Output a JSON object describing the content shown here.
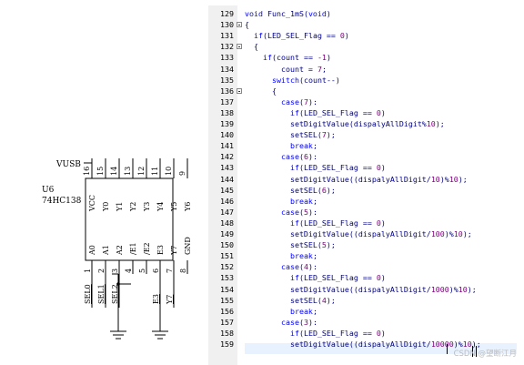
{
  "schematic": {
    "vcc_net": "VUSB",
    "ref": "U6",
    "part": "74HC138",
    "top_pins": [
      {
        "num": "16",
        "name": "VCC"
      },
      {
        "num": "15",
        "name": "Y0"
      },
      {
        "num": "14",
        "name": "Y1"
      },
      {
        "num": "13",
        "name": "Y2"
      },
      {
        "num": "12",
        "name": "Y3"
      },
      {
        "num": "11",
        "name": "Y4"
      },
      {
        "num": "10",
        "name": "Y5"
      },
      {
        "num": "9",
        "name": "Y6"
      }
    ],
    "bottom_pins": [
      {
        "num": "1",
        "name": "A0",
        "net": "SEL0"
      },
      {
        "num": "2",
        "name": "A1",
        "net": "SEL1"
      },
      {
        "num": "3",
        "name": "A2",
        "net": "SEL2"
      },
      {
        "num": "4",
        "name": "/E1",
        "net": ""
      },
      {
        "num": "5",
        "name": "/E2",
        "net": ""
      },
      {
        "num": "6",
        "name": "E3",
        "net": "E3"
      },
      {
        "num": "7",
        "name": "Y7",
        "net": "Y7"
      },
      {
        "num": "8",
        "name": "GND",
        "net": ""
      }
    ]
  },
  "editor": {
    "lines": [
      {
        "n": "129",
        "fold": false,
        "t": "void Func_1mS(void)"
      },
      {
        "n": "130",
        "fold": true,
        "t": "{"
      },
      {
        "n": "131",
        "fold": false,
        "t": "  if(LED_SEL_Flag == 0)"
      },
      {
        "n": "132",
        "fold": true,
        "t": "  {"
      },
      {
        "n": "133",
        "fold": false,
        "t": "    if(count == -1)"
      },
      {
        "n": "134",
        "fold": false,
        "t": "        count = 7;"
      },
      {
        "n": "135",
        "fold": false,
        "t": "      switch(count--)"
      },
      {
        "n": "136",
        "fold": true,
        "t": "      {"
      },
      {
        "n": "137",
        "fold": false,
        "t": "        case(7):"
      },
      {
        "n": "138",
        "fold": false,
        "t": "          if(LED_SEL_Flag == 0)"
      },
      {
        "n": "139",
        "fold": false,
        "t": "          setDigitValue(dispalyAllDigit%10);"
      },
      {
        "n": "140",
        "fold": false,
        "t": "          setSEL(7);"
      },
      {
        "n": "141",
        "fold": false,
        "t": "          break;"
      },
      {
        "n": "142",
        "fold": false,
        "t": "        case(6):"
      },
      {
        "n": "143",
        "fold": false,
        "t": "          if(LED_SEL_Flag == 0)"
      },
      {
        "n": "144",
        "fold": false,
        "t": "          setDigitValue((dispalyAllDigit/10)%10);"
      },
      {
        "n": "145",
        "fold": false,
        "t": "          setSEL(6);"
      },
      {
        "n": "146",
        "fold": false,
        "t": "          break;"
      },
      {
        "n": "147",
        "fold": false,
        "t": "        case(5):"
      },
      {
        "n": "148",
        "fold": false,
        "t": "          if(LED_SEL_Flag == 0)"
      },
      {
        "n": "149",
        "fold": false,
        "t": "          setDigitValue((dispalyAllDigit/100)%10);"
      },
      {
        "n": "150",
        "fold": false,
        "t": "          setSEL(5);"
      },
      {
        "n": "151",
        "fold": false,
        "t": "          break;"
      },
      {
        "n": "152",
        "fold": false,
        "t": "        case(4):"
      },
      {
        "n": "153",
        "fold": false,
        "t": "          if(LED_SEL_Flag == 0)"
      },
      {
        "n": "154",
        "fold": false,
        "t": "          setDigitValue((dispalyAllDigit/1000)%10);"
      },
      {
        "n": "155",
        "fold": false,
        "t": "          setSEL(4);"
      },
      {
        "n": "156",
        "fold": false,
        "t": "          break;"
      },
      {
        "n": "157",
        "fold": false,
        "t": "        case(3):"
      },
      {
        "n": "158",
        "fold": false,
        "t": "          if(LED_SEL_Flag == 0)"
      },
      {
        "n": "159",
        "fold": false,
        "t": "          setDigitValue((dispalyAllDigit/10000)%10);"
      }
    ]
  },
  "watermark": "CSDN @望断江月"
}
